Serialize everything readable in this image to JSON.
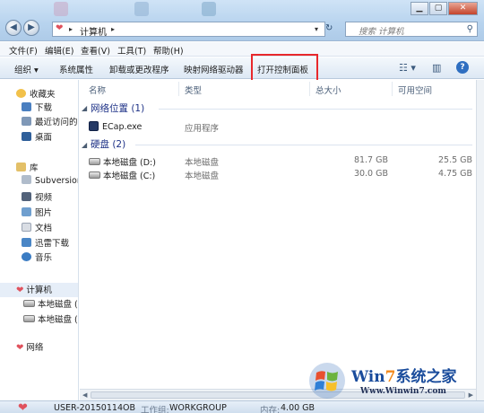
{
  "titlebar": {
    "breadcrumb": "计算机",
    "search_placeholder": "搜索 计算机"
  },
  "menu": [
    {
      "label": "文件(F)"
    },
    {
      "label": "编辑(E)"
    },
    {
      "label": "查看(V)"
    },
    {
      "label": "工具(T)"
    },
    {
      "label": "帮助(H)"
    }
  ],
  "toolbar": {
    "organize": "组织 ▾",
    "system_properties": "系统属性",
    "uninstall": "卸载或更改程序",
    "map_drive": "映射网络驱动器",
    "control_panel": "打开控制面板"
  },
  "nav": {
    "favorites": "收藏夹",
    "downloads": "下载",
    "recent": "最近访问的",
    "desktop": "桌面",
    "library": "库",
    "subversion": "Subversion",
    "videos": "视频",
    "pictures": "图片",
    "documents": "文档",
    "xunlei": "迅雷下载",
    "music": "音乐",
    "computer": "计算机",
    "drive_d": "本地磁盘 (C",
    "drive_c": "本地磁盘 (D",
    "network": "网络"
  },
  "columns": {
    "name": "名称",
    "type": "类型",
    "total": "总大小",
    "free": "可用空间"
  },
  "groups": {
    "network_location": "网络位置 (1)",
    "hard_disk": "硬盘 (2)"
  },
  "items": [
    {
      "name": "ECap.exe",
      "type": "应用程序",
      "total": "",
      "free": ""
    },
    {
      "name": "本地磁盘 (D:)",
      "type": "本地磁盘",
      "total": "81.7 GB",
      "free": "25.5 GB"
    },
    {
      "name": "本地磁盘 (C:)",
      "type": "本地磁盘",
      "total": "30.0 GB",
      "free": "4.75 GB"
    }
  ],
  "status": {
    "computer_name": "USER-20150114OB",
    "workgroup_label": "工作组:",
    "workgroup_value": "WORKGROUP",
    "memory_label": "内存:",
    "memory_value": "4.00 GB"
  },
  "watermark": {
    "title_win": "Win",
    "title_seven": "7",
    "title_rest": "系统之家",
    "url": "Www.Winwin7.com"
  },
  "colors": {
    "accent": "#1e3287",
    "highlight_box": "#e8282b",
    "titlebar": "#b7d3ee"
  }
}
